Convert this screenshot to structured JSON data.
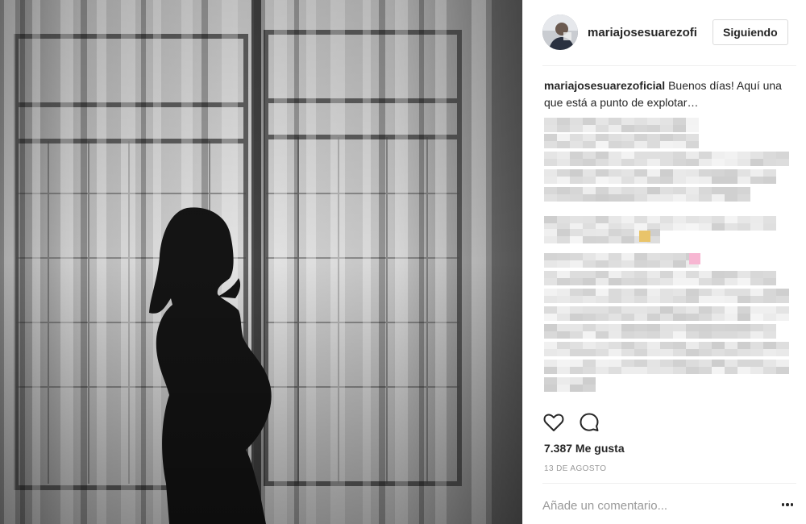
{
  "post": {
    "author": {
      "username": "mariajosesuarezoficial",
      "avatar_icon": "profile-photo",
      "follow_label": "Siguiendo"
    },
    "caption": {
      "username": "mariajosesuarezoficial",
      "text": "Buenos días! Aquí una que está a punto de explotar…",
      "hidden_text": "pixelated / blurred remaining caption"
    },
    "actions": {
      "like_icon": "heart-icon",
      "comment_icon": "comment-icon"
    },
    "likes_label": "7.387 Me gusta",
    "date_label": "13 de agosto",
    "comment_box": {
      "placeholder": "Añade un comentario..."
    },
    "more_icon": "ellipsis-icon"
  },
  "photo": {
    "description_icon": "photo-silhouette"
  },
  "colors": {
    "text": "#262626",
    "muted": "#999999",
    "border": "#dbdbdb",
    "divider": "#efefef"
  }
}
